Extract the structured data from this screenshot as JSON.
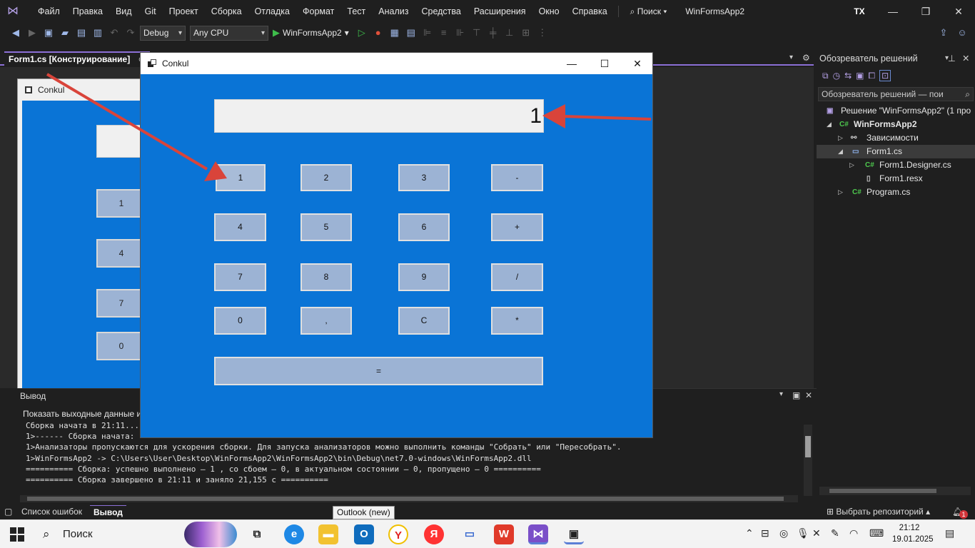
{
  "menubar": {
    "items": [
      "Файл",
      "Правка",
      "Вид",
      "Git",
      "Проект",
      "Сборка",
      "Отладка",
      "Формат",
      "Тест",
      "Анализ",
      "Средства",
      "Расширения",
      "Окно",
      "Справка"
    ],
    "search_label": "Поиск",
    "project_name": "WinFormsApp2",
    "user_initials": "TX"
  },
  "toolbar": {
    "config": "Debug",
    "platform": "Any CPU",
    "run_target": "WinFormsApp2"
  },
  "document_tab": {
    "title": "Form1.cs [Конструирование]",
    "pin_symbol": "⊕"
  },
  "designer_form": {
    "title": "Conkul",
    "buttons": [
      "1",
      "4",
      "7",
      "0"
    ]
  },
  "solution_explorer": {
    "title": "Обозреватель решений",
    "search_placeholder": "Обозреватель решений — пои",
    "tree": [
      {
        "label": "Решение \"WinFormsApp2\" (1 про",
        "icon": "solution-icon"
      },
      {
        "label": "WinFormsApp2",
        "icon": "csharp-project-icon"
      },
      {
        "label": "Зависимости",
        "icon": "dependencies-icon"
      },
      {
        "label": "Form1.cs",
        "icon": "form-icon"
      },
      {
        "label": "Form1.Designer.cs",
        "icon": "csharp-file-icon"
      },
      {
        "label": "Form1.resx",
        "icon": "resx-icon"
      },
      {
        "label": "Program.cs",
        "icon": "csharp-file-icon"
      }
    ]
  },
  "output": {
    "title": "Вывод",
    "show_label": "Показать выходные данные и",
    "lines": [
      "Сборка начата в 21:11...",
      "1>------ Сборка начата:",
      "1>Анализаторы пропускаются для ускорения сборки. Для запуска анализаторов можно выполнить команды \"Собрать\" или \"Пересобрать\".",
      "1>WinFormsApp2 -> C:\\Users\\User\\Desktop\\WinFormsApp2\\WinFormsApp2\\bin\\Debug\\net7.0-windows\\WinFormsApp2.dll",
      "========== Сборка: успешно выполнено — 1 , со сбоем — 0, в актуальном состоянии — 0, пропущено — 0 ==========",
      "========== Сборка завершено в 21:11 и заняло 21,155 с =========="
    ]
  },
  "bottom_tabs": {
    "errors": "Список ошибок",
    "output": "Вывод",
    "repo": "Выбрать репозиторий",
    "notifications": "1"
  },
  "tooltip": "Outlook (new)",
  "app_window": {
    "title": "Conkul",
    "display_value": "1",
    "buttons": {
      "b1": "1",
      "b2": "2",
      "b3": "3",
      "minus": "-",
      "b4": "4",
      "b5": "5",
      "b6": "6",
      "plus": "+",
      "b7": "7",
      "b8": "8",
      "b9": "9",
      "div": "/",
      "b0": "0",
      "comma": ",",
      "clear": "C",
      "mul": "*",
      "eq": "="
    }
  },
  "taskbar": {
    "search_label": "Поиск",
    "time": "21:12",
    "date": "19.01.2025"
  },
  "colors": {
    "accent": "#8b6fd6",
    "form_bg": "#0a74d6",
    "button_bg": "#9cb3d4",
    "arrow": "#d9443a"
  }
}
